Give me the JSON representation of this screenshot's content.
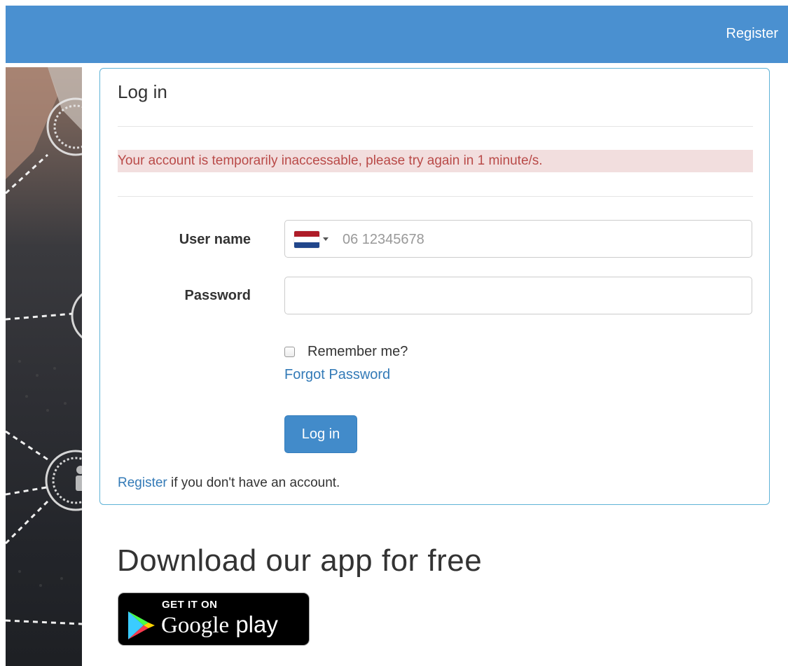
{
  "nav": {
    "register_label": "Register"
  },
  "login": {
    "title": "Log in",
    "alert_message": "Your account is temporarily inaccessable, please try again in 1 minute/s.",
    "username_label": "User name",
    "username_placeholder": "06 12345678",
    "username_country_flag": "netherlands-flag-icon",
    "password_label": "Password",
    "remember_label": "Remember me?",
    "forgot_password_label": "Forgot Password",
    "submit_label": "Log in",
    "register_link_label": "Register",
    "register_suffix": " if you don't have an account."
  },
  "download": {
    "heading": "Download our app for free",
    "badge_small_text": "GET IT ON",
    "badge_big_text_brand": "Google",
    "badge_big_text_suffix": " play"
  },
  "colors": {
    "navbar": "#4a90d0",
    "panel_border": "#5fb3d7",
    "alert_bg": "#f2dede",
    "alert_text": "#b94a48",
    "link": "#337ab7",
    "primary_button": "#428bca"
  }
}
